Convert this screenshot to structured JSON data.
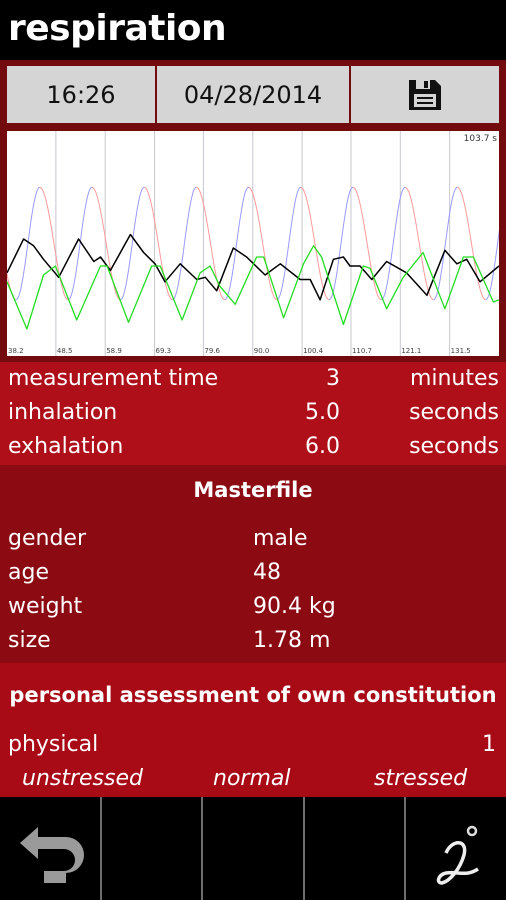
{
  "header": {
    "title": "respiration"
  },
  "toolbar": {
    "time": "16:26",
    "date": "04/28/2014",
    "save_icon": "floppy-disk-icon"
  },
  "chart_data": {
    "type": "line",
    "title": "",
    "window_label": "103.7 s",
    "xlim": [
      38.2,
      141.9
    ],
    "ylim": [
      0,
      100
    ],
    "grid": "vertical",
    "x_ticks": [
      "38.2",
      "48.5",
      "58.9",
      "69.3",
      "79.6",
      "90.0",
      "100.4",
      "110.7",
      "121.1",
      "131.5"
    ],
    "guide": {
      "inhale_color": "#9a9aff",
      "exhale_color": "#ff9a9a",
      "inhale_s": 5,
      "exhale_s": 6,
      "first_peak": 45.1,
      "min": 25,
      "max": 75
    },
    "series": [
      {
        "color": "#000000",
        "x": [
          38.2,
          41.7,
          43.8,
          45.9,
          49.1,
          53.3,
          56.5,
          57.9,
          60.0,
          64.2,
          67.0,
          69.4,
          71.5,
          74.7,
          78.2,
          80.0,
          82.4,
          85.9,
          88.7,
          92.6,
          95.8,
          100.0,
          102.1,
          104.2,
          107.0,
          109.1,
          110.5,
          112.6,
          115.1,
          118.2,
          122.4,
          126.7,
          130.5,
          133.0,
          135.1,
          137.9,
          141.9
        ],
        "y": [
          37,
          52,
          49,
          43,
          35,
          52,
          42,
          44,
          38,
          54,
          46,
          41,
          33,
          41,
          34,
          35,
          29,
          48,
          44,
          36,
          41,
          34,
          34,
          25,
          43,
          44,
          40,
          40,
          34,
          42,
          37,
          27,
          47,
          41,
          43,
          33,
          40
        ]
      },
      {
        "color": "#22dd22",
        "x": [
          38.2,
          42.4,
          45.9,
          48.4,
          52.9,
          57.9,
          59.3,
          63.8,
          68.7,
          70.5,
          75.1,
          78.9,
          81.0,
          83.1,
          86.3,
          90.8,
          92.3,
          96.5,
          100.7,
          102.8,
          104.5,
          109.1,
          113.3,
          114.7,
          118.2,
          121.7,
          125.9,
          130.5,
          134.4,
          136.5,
          140.7,
          141.9
        ],
        "y": [
          33,
          12,
          36,
          40,
          16,
          40,
          40,
          15,
          40,
          40,
          16,
          37,
          40,
          31,
          23,
          44,
          44,
          17,
          41,
          49,
          44,
          14,
          40,
          39,
          21,
          35,
          46,
          21,
          44,
          44,
          24,
          25
        ]
      }
    ]
  },
  "measurement": [
    {
      "label": "measurement time",
      "value": "3",
      "unit": "minutes"
    },
    {
      "label": "inhalation",
      "value": "5.0",
      "unit": "seconds"
    },
    {
      "label": "exhalation",
      "value": "6.0",
      "unit": "seconds"
    }
  ],
  "masterfile": {
    "title": "Masterfile",
    "rows": [
      {
        "label": "gender",
        "value": "male"
      },
      {
        "label": "age",
        "value": "48"
      },
      {
        "label": "weight",
        "value": "90.4 kg"
      },
      {
        "label": "size",
        "value": "1.78 m"
      }
    ]
  },
  "assessment": {
    "title": "personal assessment of own constitution",
    "label": "physical",
    "value": "1",
    "scale": [
      "unstressed",
      "normal",
      "stressed"
    ]
  },
  "bottombar": {
    "back_icon": "back-arrow-icon",
    "info_icon": "info-icon"
  }
}
